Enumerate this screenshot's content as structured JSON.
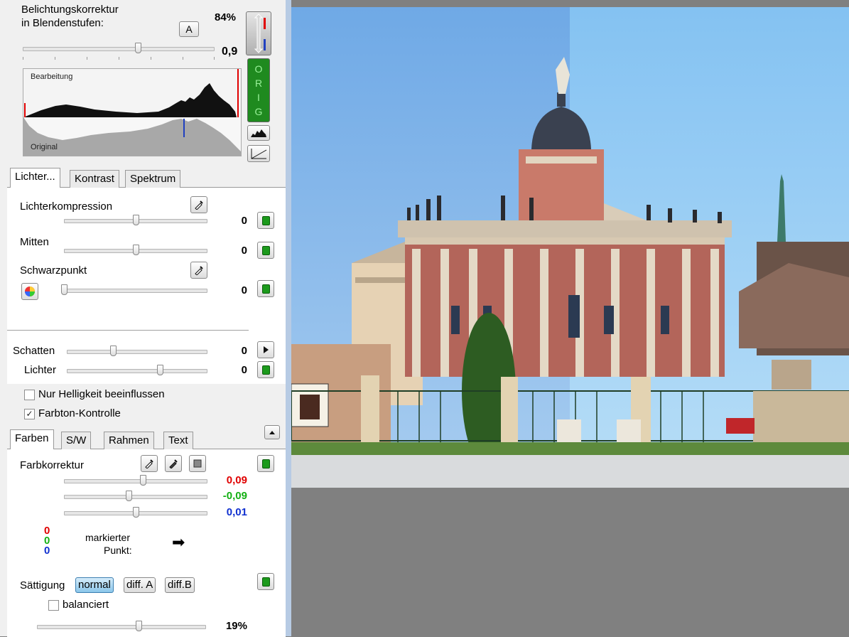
{
  "exposure": {
    "label_line1": "Belichtungskorrektur",
    "label_line2": "in Blendenstufen:",
    "auto_button": "A",
    "percent": "84%",
    "value": "0,9",
    "slider_value": 0.6
  },
  "histogram": {
    "top_label": "Bearbeitung",
    "bottom_label": "Original"
  },
  "side_buttons": {
    "orig_letters": [
      "O",
      "R",
      "I",
      "G"
    ]
  },
  "tone_tabs": [
    "Lichter...",
    "Kontrast",
    "Spektrum"
  ],
  "tone": {
    "lichterkompression": {
      "label": "Lichterkompression",
      "value": "0",
      "slider_value": 0.5
    },
    "mitten": {
      "label": "Mitten",
      "value": "0",
      "slider_value": 0.5
    },
    "schwarzpunkt": {
      "label": "Schwarzpunkt",
      "value": "0",
      "slider_value": 0.0
    },
    "schatten": {
      "label": "Schatten",
      "value": "0",
      "slider_value": 0.33
    },
    "lichter": {
      "label": "Lichter",
      "value": "0",
      "slider_value": 0.66
    }
  },
  "options": {
    "nur_helligkeit": {
      "label": "Nur Helligkeit beeinflussen",
      "checked": false
    },
    "farbton": {
      "label": "Farbton-Kontrolle",
      "checked": true,
      "mark": "✓"
    }
  },
  "color_tabs": [
    "Farben",
    "S/W",
    "Rahmen",
    "Text"
  ],
  "farben": {
    "label": "Farbkorrektur",
    "red": {
      "value": "0,09",
      "color": "#e00000",
      "slider_value": 0.55
    },
    "green": {
      "value": "-0,09",
      "color": "#14b014",
      "slider_value": 0.45
    },
    "blue": {
      "value": "0,01",
      "color": "#1030d0",
      "slider_value": 0.5
    },
    "point_rgb": [
      "0",
      "0",
      "0"
    ],
    "point_label_1": "markierter",
    "point_label_2": "Punkt:",
    "arrow": "➡"
  },
  "saettigung": {
    "label": "Sättigung",
    "buttons": [
      "normal",
      "diff. A",
      "diff.B"
    ],
    "selected": "normal",
    "balanced_label": "balanciert",
    "value": "19%",
    "slider_value": 0.6
  },
  "colors": {
    "accent_green": "#1c9a1c",
    "orig_bg": "#1f8a1f",
    "hist_red": "#e00000",
    "hist_blue": "#2040c0"
  }
}
